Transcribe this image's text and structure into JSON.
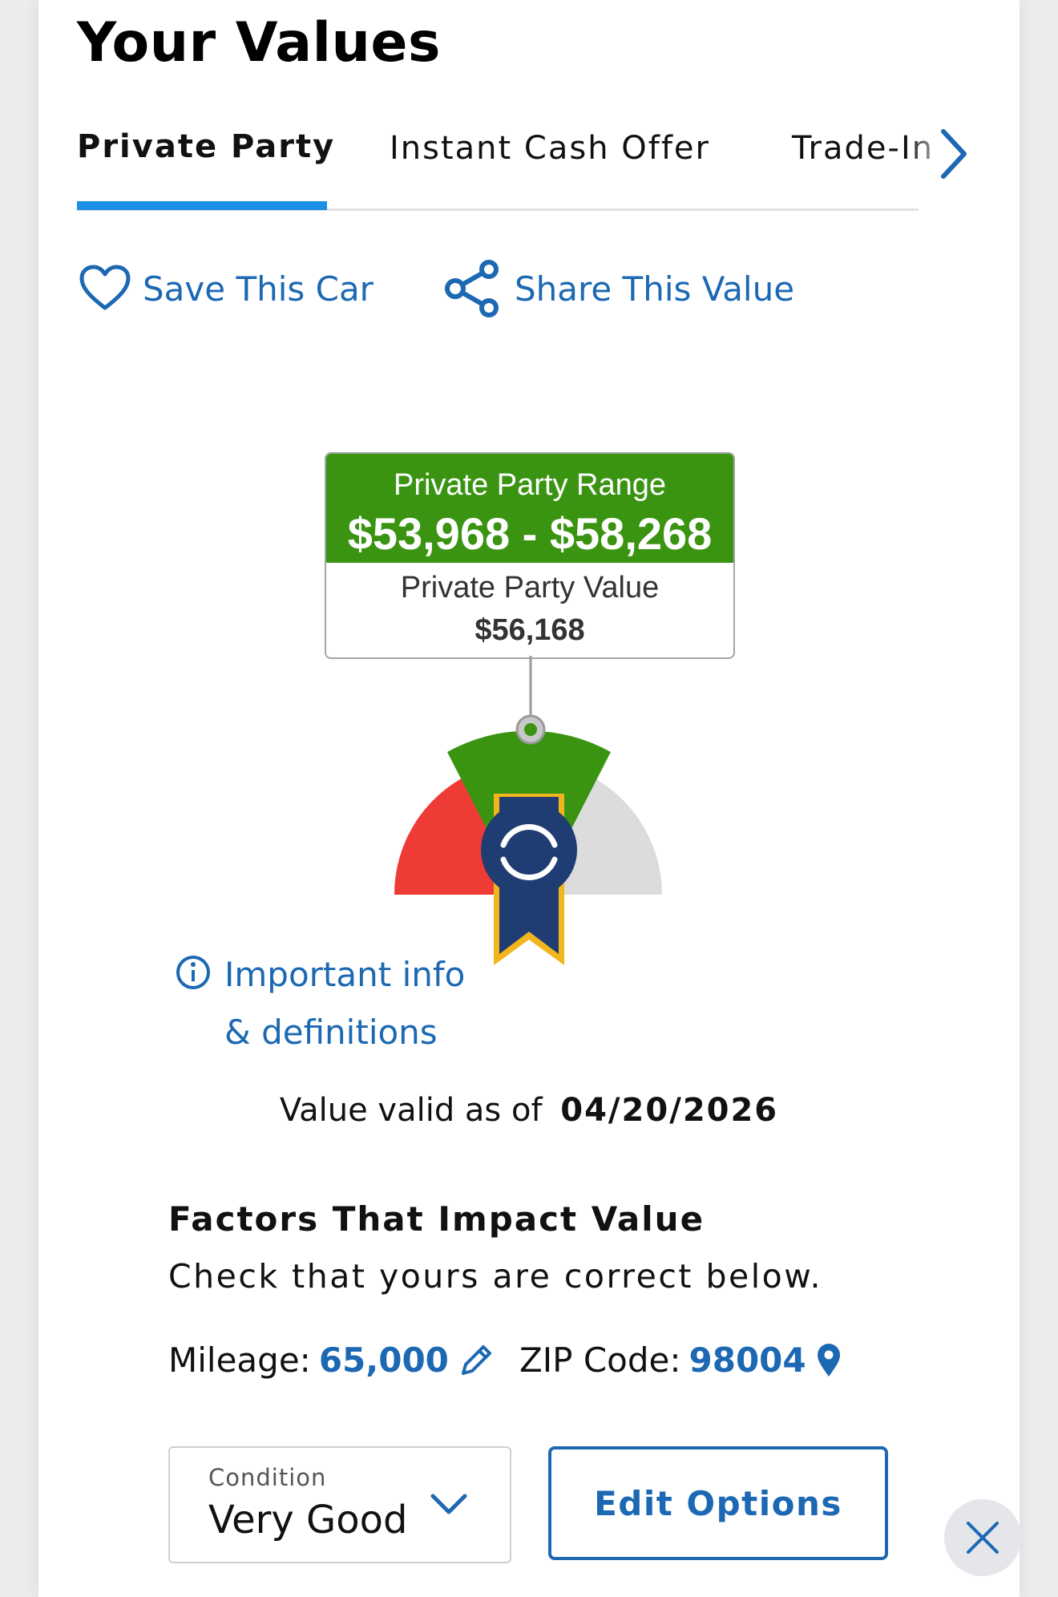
{
  "page": {
    "title": "Your Values"
  },
  "tabs": [
    {
      "label": "Private Party",
      "active": true
    },
    {
      "label": "Instant Cash Offer",
      "active": false
    },
    {
      "label": "Trade-In",
      "active": false
    }
  ],
  "actions": {
    "save_label": "Save This Car",
    "share_label": "Share This Value"
  },
  "value_box": {
    "range_label": "Private Party Range",
    "range_values": "$53,968 - $58,268",
    "value_label": "Private Party Value",
    "value": "$56,168"
  },
  "info": {
    "line1": "Important info",
    "line2": "& definitions"
  },
  "validity": {
    "label": "Value valid as of",
    "date": "04/20/2026"
  },
  "factors": {
    "title": "Factors That Impact Value",
    "subtitle": "Check that yours are correct below.",
    "mileage_label": "Mileage:",
    "mileage_value": "65,000",
    "zip_label": "ZIP Code:",
    "zip_value": "98004"
  },
  "condition": {
    "label": "Condition",
    "value": "Very Good"
  },
  "edit_options_label": "Edit Options",
  "colors": {
    "accent_blue": "#1c68b3",
    "tab_underline": "#1a8fe3",
    "range_green": "#3a9412",
    "gauge_red": "#ef3b36",
    "gauge_gray": "#dcdcdc",
    "badge_navy": "#1f3c73",
    "badge_gold": "#f2b51b"
  },
  "icons": [
    "heart-icon",
    "share-icon",
    "chevron-right-icon",
    "info-icon",
    "pencil-icon",
    "map-pin-icon",
    "chevron-down-icon",
    "close-icon",
    "kbb-badge-icon"
  ]
}
